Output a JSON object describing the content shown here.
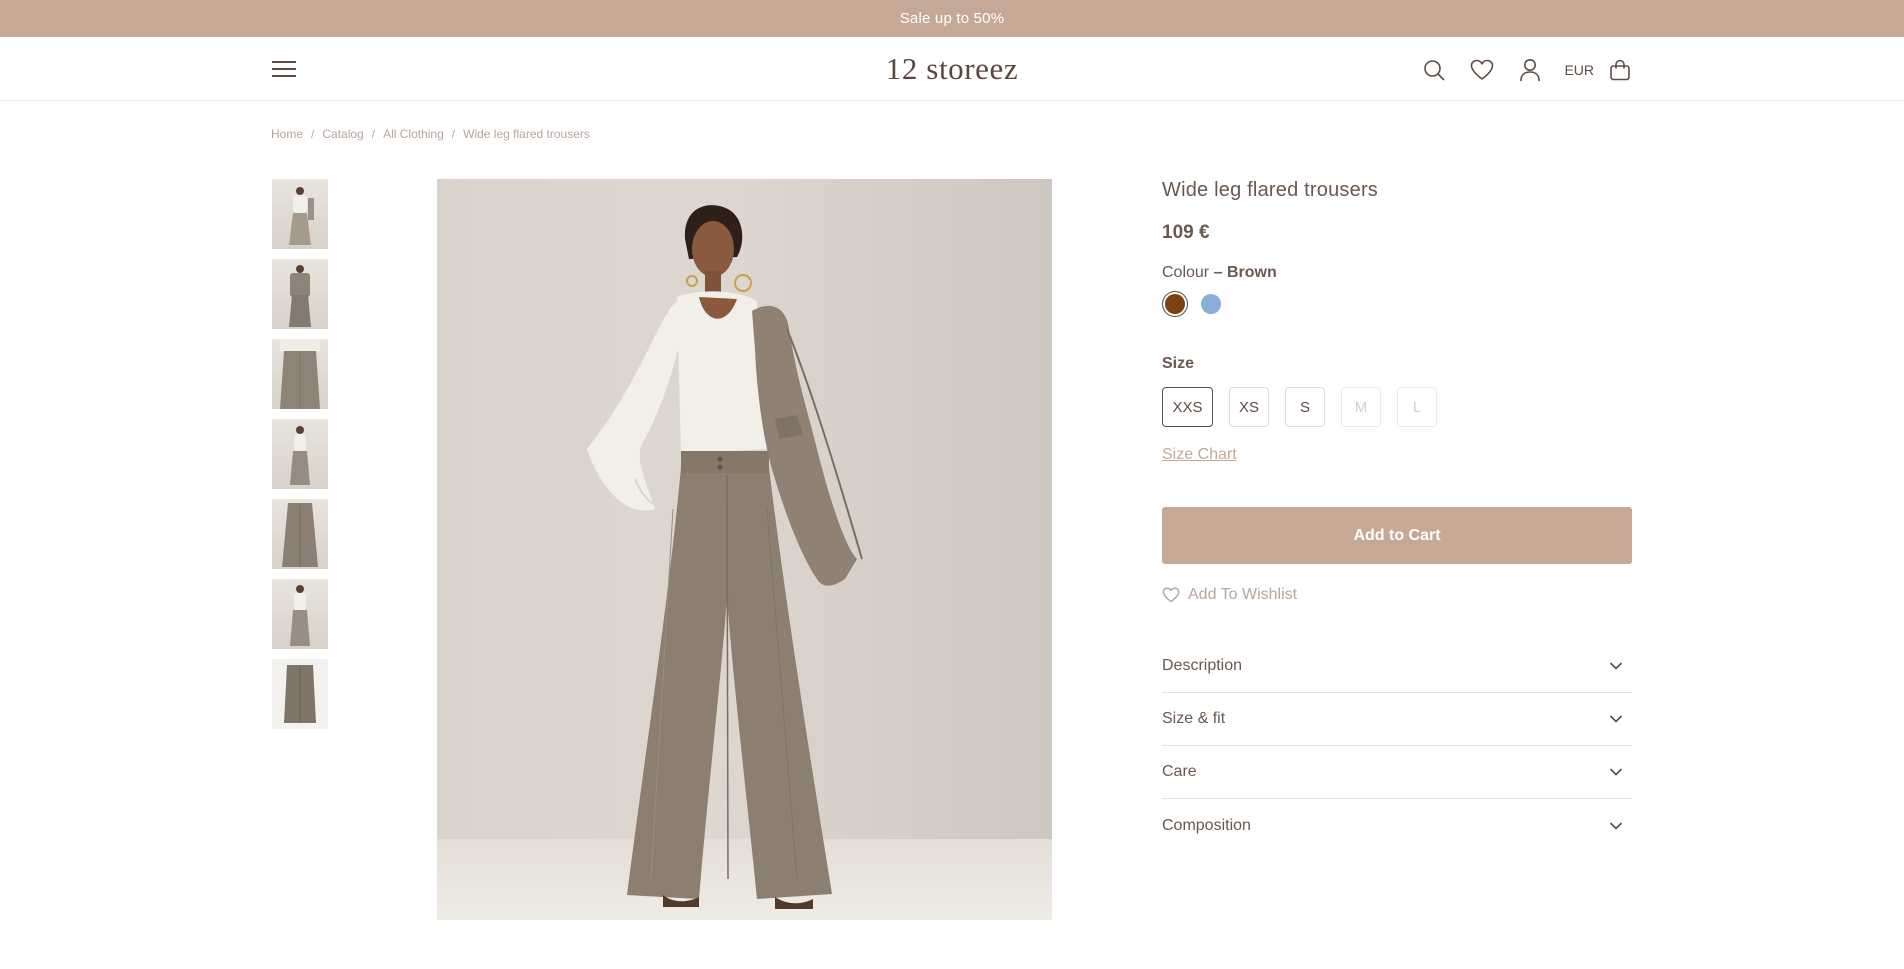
{
  "promo": {
    "text": "Sale up to 50%"
  },
  "header": {
    "logo": "12 storeez",
    "currency": "EUR",
    "icons": [
      "menu-icon",
      "search-icon",
      "heart-icon",
      "user-icon",
      "bag-icon"
    ]
  },
  "breadcrumb": {
    "items": [
      "Home",
      "Catalog",
      "All Clothing",
      "Wide leg flared trousers"
    ],
    "separator": "/"
  },
  "product": {
    "title": "Wide leg flared trousers",
    "price": "109 €",
    "colour_label": "Colour",
    "colour_value": "– Brown",
    "colours": [
      {
        "name": "Brown",
        "hex": "#7a4311",
        "selected": true
      },
      {
        "name": "Blue",
        "hex": "#86aed6",
        "selected": false
      }
    ],
    "size_label": "Size",
    "sizes": [
      {
        "label": "XXS",
        "state": "selected"
      },
      {
        "label": "XS",
        "state": "available"
      },
      {
        "label": "S",
        "state": "available"
      },
      {
        "label": "M",
        "state": "unavailable"
      },
      {
        "label": "L",
        "state": "unavailable"
      }
    ],
    "size_chart": "Size Chart",
    "add_to_cart": "Add to Cart",
    "wishlist": "Add To Wishlist",
    "accordion": [
      "Description",
      "Size & fit",
      "Care",
      "Composition"
    ]
  },
  "gallery": {
    "thumbnail_count": 7
  },
  "colors": {
    "accent": "#c6a897",
    "text": "#5e4b43"
  }
}
